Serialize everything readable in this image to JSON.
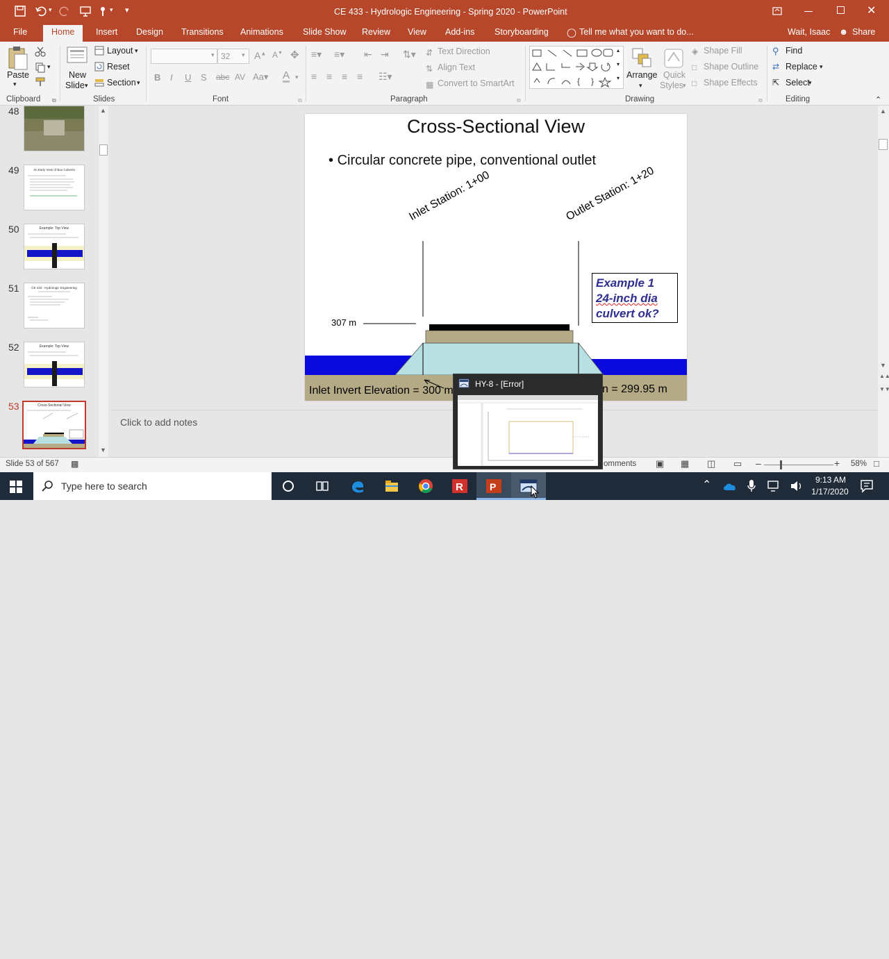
{
  "window": {
    "title": "CE 433 - Hydrologic Engineering - Spring 2020 - PowerPoint"
  },
  "tabs": [
    "File",
    "Home",
    "Insert",
    "Design",
    "Transitions",
    "Animations",
    "Slide Show",
    "Review",
    "View",
    "Add-ins",
    "Storyboarding"
  ],
  "tellme": "Tell me what you want to do...",
  "user": "Wait, Isaac",
  "share": "Share",
  "ribbon": {
    "clipboard": {
      "paste": "Paste",
      "label": "Clipboard"
    },
    "slides": {
      "new_slide": "New",
      "new_slide2": "Slide",
      "layout": "Layout",
      "reset": "Reset",
      "section": "Section",
      "label": "Slides"
    },
    "font": {
      "size": "32",
      "label": "Font",
      "bold": "B",
      "italic": "I",
      "underline": "U",
      "strike": "S"
    },
    "paragraph": {
      "text_direction": "Text Direction",
      "align_text": "Align Text",
      "convert_smartart": "Convert to SmartArt",
      "label": "Paragraph"
    },
    "drawing": {
      "arrange": "Arrange",
      "quick_styles": "Quick",
      "quick_styles2": "Styles",
      "shape_fill": "Shape Fill",
      "shape_outline": "Shape Outline",
      "shape_effects": "Shape Effects",
      "label": "Drawing"
    },
    "editing": {
      "find": "Find",
      "replace": "Replace",
      "select": "Select",
      "label": "Editing"
    }
  },
  "thumbnails": [
    {
      "num": "48"
    },
    {
      "num": "49",
      "title": "An Early View of Box Culverts"
    },
    {
      "num": "50",
      "title": "Example: Top View"
    },
    {
      "num": "51",
      "title": "CE 433 - Hydrologic Engineering"
    },
    {
      "num": "52",
      "title": "Example: Top View"
    },
    {
      "num": "53",
      "title": "Cross-Sectional View"
    }
  ],
  "slide": {
    "title": "Cross-Sectional View",
    "bullet": "Circular concrete pipe, conventional outlet",
    "inlet_station": "Inlet Station: 1+00",
    "outlet_station": "Outlet Station: 1+20",
    "elev_label": "307 m",
    "example_line1": "Example 1",
    "example_line2": "24-inch dia",
    "example_line3": "culvert ok?",
    "inlet_invert": "Inlet Invert Elevation = 300 m",
    "outlet_invert": "n = 299.95 m"
  },
  "notes_placeholder": "Click to add notes",
  "status": {
    "slide_info": "Slide 53 of 567",
    "comments": "omments",
    "zoom": "58%"
  },
  "popup": {
    "title": "HY-8 - [Error]"
  },
  "taskbar": {
    "search_placeholder": "Type here to search",
    "time": "9:13 AM",
    "date": "1/17/2020"
  },
  "colors": {
    "accent": "#b7472a",
    "water": "#0a0adc",
    "soil": "#b5aa86",
    "culvert": "#b8e0e3",
    "example_text": "#2f2f8f"
  }
}
